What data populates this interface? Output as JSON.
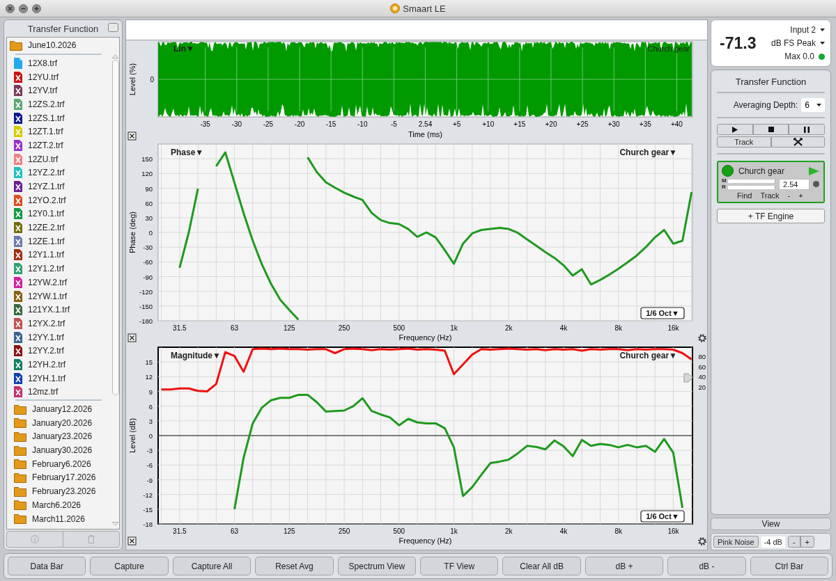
{
  "window": {
    "title": "Smaart LE"
  },
  "sidebar": {
    "title": "Transfer Function",
    "current_folder": "June10.2026",
    "files": [
      {
        "name": "12X8.trf",
        "kind": "doc",
        "color": "#22aaee"
      },
      {
        "name": "12YU.trf",
        "kind": "x",
        "color": "#cc1111"
      },
      {
        "name": "12YV.trf",
        "kind": "x",
        "color": "#7a3a5a"
      },
      {
        "name": "12ZS.2.trf",
        "kind": "x",
        "color": "#5aa870"
      },
      {
        "name": "12ZS.1.trf",
        "kind": "x",
        "color": "#0a1a8a"
      },
      {
        "name": "12ZT.1.trf",
        "kind": "x",
        "color": "#d4cc00"
      },
      {
        "name": "12ZT.2.trf",
        "kind": "x",
        "color": "#9a30c8"
      },
      {
        "name": "12ZU.trf",
        "kind": "x",
        "color": "#f08080"
      },
      {
        "name": "12YZ.2.trf",
        "kind": "x",
        "color": "#20c0c0"
      },
      {
        "name": "12YZ.1.trf",
        "kind": "x",
        "color": "#6a2090"
      },
      {
        "name": "12YO.2.trf",
        "kind": "x",
        "color": "#e04a1a"
      },
      {
        "name": "12Y0.1.trf",
        "kind": "x",
        "color": "#119944"
      },
      {
        "name": "12ZE.2.trf",
        "kind": "x",
        "color": "#707010"
      },
      {
        "name": "12ZE.1.trf",
        "kind": "x",
        "color": "#6a78b0"
      },
      {
        "name": "12Y1.1.trf",
        "kind": "x",
        "color": "#a03010"
      },
      {
        "name": "12Y1.2.trf",
        "kind": "x",
        "color": "#30a070"
      },
      {
        "name": "12YW.2.trf",
        "kind": "x",
        "color": "#d020a0"
      },
      {
        "name": "12YW.1.trf",
        "kind": "x",
        "color": "#8a6010"
      },
      {
        "name": "121YX.1.trf",
        "kind": "x",
        "color": "#3a6a40"
      },
      {
        "name": "12YX.2.trf",
        "kind": "x",
        "color": "#c05050"
      },
      {
        "name": "12YY.1.trf",
        "kind": "x",
        "color": "#3a6090"
      },
      {
        "name": "12YY.2.trf",
        "kind": "x",
        "color": "#8a1010"
      },
      {
        "name": "12YH.2.trf",
        "kind": "x",
        "color": "#108060"
      },
      {
        "name": "12YH.1.trf",
        "kind": "x",
        "color": "#1040b0"
      },
      {
        "name": "12mz.trf",
        "kind": "x",
        "color": "#c03070"
      }
    ],
    "folders": [
      "January12.2026",
      "January20.2026",
      "January23.2026",
      "January30.2026",
      "February6.2026",
      "February17.2026",
      "February23.2026",
      "March6.2026",
      "March11.2026"
    ]
  },
  "time_plot": {
    "mode": "Lin▼",
    "source": "Church gear",
    "ylabel": "Level (%)",
    "yticks": [
      "0"
    ],
    "xticks": [
      "-35",
      "-30",
      "-25",
      "-20",
      "-15",
      "-10",
      "-5",
      "2.54",
      "+5",
      "+10",
      "+15",
      "+20",
      "+25",
      "+30",
      "+35",
      "+40"
    ],
    "xlabel": "Time (ms)"
  },
  "phase_plot": {
    "title": "Phase▼",
    "source": "Church gear▼",
    "resolution": "1/6 Oct▼",
    "selected": false,
    "chart_data": {
      "type": "line",
      "grid": true,
      "xlabel": "Frequency (Hz)",
      "ylabel": "Phase (deg)",
      "ylim": [
        -180,
        180
      ],
      "categories": [
        null,
        null,
        "31.5",
        null,
        null,
        null,
        null,
        null,
        "63",
        null,
        null,
        null,
        null,
        null,
        "125",
        null,
        null,
        null,
        null,
        null,
        "250",
        null,
        null,
        null,
        null,
        null,
        "500",
        null,
        null,
        null,
        null,
        null,
        "1k",
        null,
        null,
        null,
        null,
        null,
        "2k",
        null,
        null,
        null,
        null,
        null,
        "4k",
        null,
        null,
        null,
        null,
        null,
        "8k",
        null,
        null,
        null,
        null,
        null,
        "16k",
        null,
        null
      ],
      "yticks": [
        150,
        120,
        90,
        60,
        30,
        0,
        -30,
        -60,
        -90,
        -120,
        -150,
        -180
      ],
      "series": [
        {
          "color": "#1e9a1e",
          "values": [
            null,
            null,
            -72,
            0,
            89,
            null,
            135,
            163,
            101,
            39,
            -17,
            -65,
            -105,
            -137,
            -158,
            -178,
            153,
            123,
            102,
            91,
            81,
            73,
            66,
            40,
            25,
            19,
            17,
            7,
            -9,
            0,
            -10,
            -36,
            -64,
            -23,
            -2,
            5,
            7,
            9,
            7,
            -1,
            -14,
            -27,
            -40,
            -52,
            -67,
            -88,
            -75,
            -106,
            -97,
            -86,
            -74,
            -61,
            -47,
            -30,
            -10,
            5,
            -23,
            -17,
            82
          ]
        }
      ]
    }
  },
  "magnitude_plot": {
    "title": "Magnitude▼",
    "source": "Church gear▼",
    "resolution": "1/6 Oct▼",
    "selected": true,
    "secondary_yticks": [
      "80",
      "60",
      "40",
      "20"
    ],
    "chart_data": {
      "type": "line",
      "grid": true,
      "xlabel": "Frequency (Hz)",
      "ylabel": "Level (dB)",
      "ylim": [
        -18,
        18
      ],
      "categories": [
        null,
        null,
        "31.5",
        null,
        null,
        null,
        null,
        null,
        "63",
        null,
        null,
        null,
        null,
        null,
        "125",
        null,
        null,
        null,
        null,
        null,
        "250",
        null,
        null,
        null,
        null,
        null,
        "500",
        null,
        null,
        null,
        null,
        null,
        "1k",
        null,
        null,
        null,
        null,
        null,
        "2k",
        null,
        null,
        null,
        null,
        null,
        "4k",
        null,
        null,
        null,
        null,
        null,
        "8k",
        null,
        null,
        null,
        null,
        null,
        "16k",
        null,
        null
      ],
      "yticks": [
        15,
        12,
        9,
        6,
        3,
        0,
        -3,
        -6,
        -9,
        -12,
        -15,
        -18
      ],
      "ref_lines": [
        {
          "axis": "y",
          "value": 0
        }
      ],
      "series": [
        {
          "color": "#ee1111",
          "values": [
            9.4,
            9.4,
            9.6,
            9.6,
            9.1,
            9.0,
            10.5,
            17.0,
            16.2,
            13.0,
            17.6,
            17.7,
            17.6,
            17.7,
            17.6,
            17.6,
            17.5,
            17.6,
            17.6,
            16.8,
            17.6,
            17.7,
            17.6,
            17.4,
            17.6,
            17.5,
            17.6,
            17.7,
            17.5,
            17.6,
            17.5,
            17.3,
            12.5,
            14.5,
            16.5,
            17.6,
            17.5,
            17.6,
            17.7,
            17.6,
            17.5,
            17.6,
            17.4,
            17.6,
            17.5,
            17.6,
            17.3,
            17.6,
            17.5,
            17.6,
            17.6,
            17.4,
            17.6,
            17.5,
            17.6,
            17.6,
            17.5,
            16.8,
            15.5
          ]
        },
        {
          "color": "#1e9a1e",
          "values": [
            null,
            null,
            null,
            null,
            null,
            null,
            null,
            null,
            -15,
            -4.5,
            2.5,
            5.7,
            7.2,
            7.7,
            7.7,
            8.3,
            8.3,
            6.8,
            4.9,
            5.0,
            5.1,
            6.0,
            7.6,
            5.0,
            4.3,
            3.7,
            2.1,
            3.4,
            2.7,
            2.5,
            2.5,
            1.5,
            -2.4,
            -12.3,
            -10.5,
            -8.0,
            -5.6,
            -5.3,
            -4.9,
            -3.6,
            -2.1,
            -2.3,
            -2.8,
            -1.0,
            -2.2,
            -4.2,
            -0.9,
            -2.1,
            -1.7,
            -1.9,
            -2.4,
            -1.9,
            -2.4,
            -2.1,
            -3.3,
            -0.7,
            -3.5,
            -14.7,
            null
          ]
        }
      ]
    }
  },
  "meter": {
    "value": "-71.3",
    "input": "Input 2",
    "scale": "dB FS Peak",
    "max": "Max 0.0",
    "max_indicator_on": true
  },
  "tf_panel": {
    "title": "Transfer Function",
    "averaging_label": "Averaging Depth:",
    "averaging_value": "6",
    "track_button": "Track",
    "engine": {
      "name": "Church gear",
      "active": true,
      "meter_labels": [
        "M",
        "R"
      ],
      "delay": "2.54",
      "buttons": [
        "Find",
        "Track",
        "-",
        "+"
      ]
    },
    "add_engine": "+ TF Engine"
  },
  "view_button": "View",
  "generator": {
    "button": "Pink Noise",
    "level": "-4 dB",
    "buttons": [
      "-",
      "+"
    ]
  },
  "bottom_buttons": [
    "Data Bar",
    "Capture",
    "Capture All",
    "Reset Avg",
    "Spectrum View",
    "TF View",
    "Clear All dB",
    "dB +",
    "dB -",
    "Ctrl Bar"
  ]
}
